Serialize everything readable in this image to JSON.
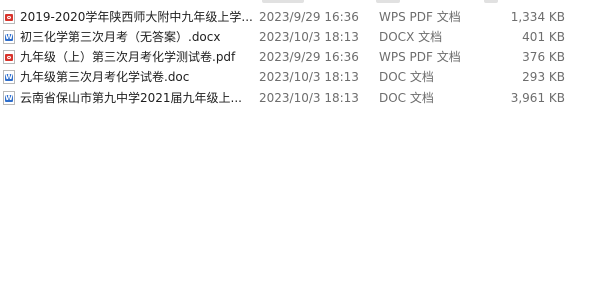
{
  "files": [
    {
      "name": "2019-2020学年陕西师大附中九年级上学...",
      "date": "2023/9/29 16:36",
      "type": "WPS PDF 文档",
      "size": "1,334 KB",
      "icon": "pdf-file-icon"
    },
    {
      "name": "初三化学第三次月考（无答案）.docx",
      "date": "2023/10/3 18:13",
      "type": "DOCX 文档",
      "size": "401 KB",
      "icon": "word-file-icon"
    },
    {
      "name": "九年级（上）第三次月考化学测试卷.pdf",
      "date": "2023/9/29 16:36",
      "type": "WPS PDF 文档",
      "size": "376 KB",
      "icon": "pdf-file-icon"
    },
    {
      "name": "九年级第三次月考化学试卷.doc",
      "date": "2023/10/3 18:13",
      "type": "DOC 文档",
      "size": "293 KB",
      "icon": "word-file-icon"
    },
    {
      "name": "云南省保山市第九中学2021届九年级上...",
      "date": "2023/10/3 18:13",
      "type": "DOC 文档",
      "size": "3,961 KB",
      "icon": "word-file-icon"
    }
  ],
  "colors": {
    "pdf_accent": "#d8342c",
    "word_accent": "#2f6ecb",
    "secondary_text": "#6d6d6d"
  }
}
